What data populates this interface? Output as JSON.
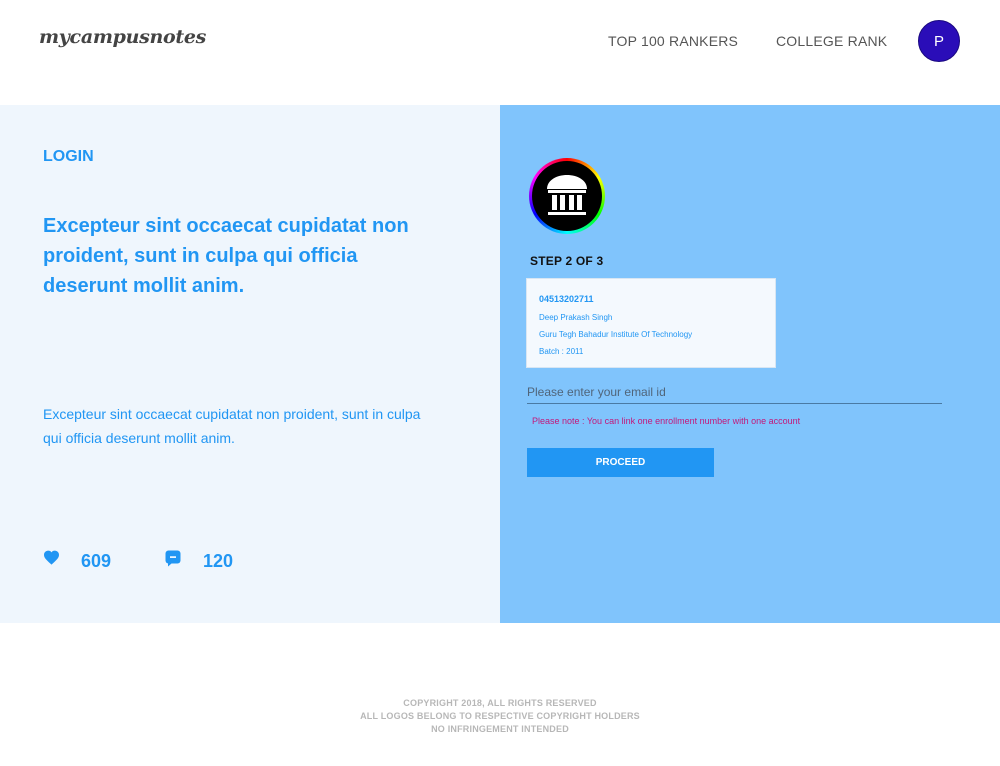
{
  "header": {
    "logo_text": "mycampusnotes",
    "nav": {
      "top_rankers": "TOP 100 RANKERS",
      "college_rank": "COLLEGE RANK"
    },
    "avatar_initial": "P"
  },
  "intro": {
    "title": "LOGIN",
    "headline": "Excepteur sint occaecat cupidatat non proident, sunt in culpa qui officia deserunt mollit anim.",
    "description": "Excepteur sint occaecat cupidatat non proident, sunt in culpa qui officia deserunt mollit anim.",
    "stats": {
      "likes": "609",
      "comments": "120"
    }
  },
  "form": {
    "step_label": "STEP 2 OF 3",
    "card": {
      "enrollment_number": "04513202711",
      "name": "Deep Prakash Singh",
      "institute": "Guru Tegh Bahadur Institute Of Technology",
      "batch": "Batch : 2011"
    },
    "email_placeholder": "Please enter your email id",
    "email_value": "",
    "note": "Please note : You can link one enrollment number with one account",
    "proceed_label": "PROCEED"
  },
  "footer": {
    "line1": "COPYRIGHT 2018, ALL RIGHTS RESERVED",
    "line2": "ALL LOGOS BELONG TO RESPECTIVE COPYRIGHT HOLDERS",
    "line3": "NO INFRINGEMENT INTENDED"
  },
  "colors": {
    "accent": "#2196f3",
    "left_panel_bg": "#eff6fd",
    "right_panel_bg": "#80c4fc",
    "avatar_bg": "#2a0db8",
    "note_text": "#c2187a"
  },
  "icons": {
    "likes": "heart-icon",
    "comments": "comment-icon",
    "institute": "institute-building-icon"
  }
}
